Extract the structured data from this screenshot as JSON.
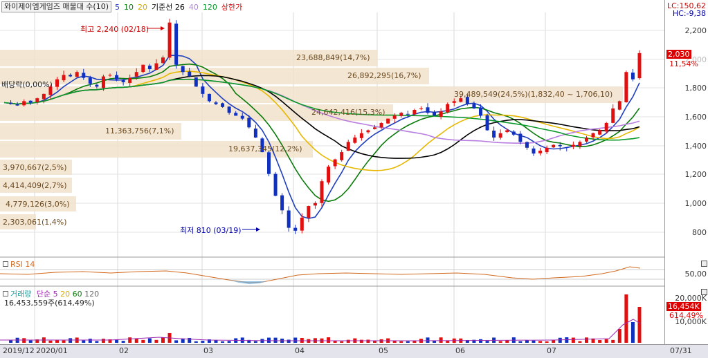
{
  "legend": {
    "title": "와이제이엠게임즈 매물대 수(10)",
    "ma": [
      "5",
      "10",
      "20",
      "기준선 26",
      "40",
      "120"
    ],
    "ma_colors": [
      "#1f3fbf",
      "#0a7a0a",
      "#e6b800",
      "#000000",
      "#b77de0",
      "#0a9a2a"
    ],
    "extra": "상한가"
  },
  "info": {
    "lc": "LC:150,62",
    "hc": "HC:-9,38"
  },
  "price_axis": {
    "ticks": [
      "2,200",
      "2,000",
      "1,800",
      "1,600",
      "1,400",
      "1,200",
      "1,000",
      "800"
    ],
    "current": "2,030",
    "change": "11,54%"
  },
  "annotations": {
    "high": "최고 2,240 (02/18)",
    "low": "최저 810 (03/19)",
    "dividend": "배당락(0,00%)"
  },
  "volume_profile": [
    {
      "text": "23,688,849(14,7%)"
    },
    {
      "text": "26,892,295(16,7%)"
    },
    {
      "text": "39,489,549(24,5%)(1,832,40 ~ 1,706,10)"
    },
    {
      "text": "24,642,416(15,3%)"
    },
    {
      "text": "11,363,756(7,1%)"
    },
    {
      "text": "19,637,345(12,2%)"
    },
    {
      "text": "3,970,667(2,5%)"
    },
    {
      "text": "4,414,409(2,7%)"
    },
    {
      "text": "4,779,126(3,0%)"
    },
    {
      "text": "2,303,061(1,4%)"
    }
  ],
  "rsi": {
    "label": "RSI 14",
    "tick": "50,00"
  },
  "volume": {
    "label": "거래량",
    "ma_label": "단순",
    "ma": [
      "5",
      "20",
      "60",
      "120"
    ],
    "value": "16,453,559주(614,49%)",
    "ticks": [
      "20,000K",
      "10,000K"
    ],
    "current": "16,454K",
    "pct": "614,49%"
  },
  "x_axis": {
    "ticks": [
      "2019/12",
      "2020/01",
      "02",
      "03",
      "04",
      "05",
      "06",
      "07"
    ],
    "end": "07/31"
  },
  "chart_data": {
    "type": "candlestick",
    "title": "와이제이엠게임즈 매물대 수(10)",
    "ylim": [
      700,
      2300
    ],
    "price_path": [
      1690,
      1680,
      1670,
      1700,
      1690,
      1720,
      1750,
      1800,
      1850,
      1880,
      1870,
      1900,
      1860,
      1820,
      1800,
      1870,
      1880,
      1850,
      1830,
      1860,
      1900,
      1950,
      1920,
      1960,
      2000,
      2240,
      1950,
      1900,
      1870,
      1800,
      1750,
      1700,
      1680,
      1660,
      1620,
      1600,
      1580,
      1520,
      1450,
      1350,
      1200,
      1050,
      950,
      830,
      810,
      900,
      980,
      1000,
      1150,
      1250,
      1300,
      1350,
      1420,
      1450,
      1480,
      1500,
      1520,
      1550,
      1580,
      1600,
      1620,
      1610,
      1640,
      1650,
      1620,
      1600,
      1630,
      1680,
      1700,
      1720,
      1680,
      1650,
      1600,
      1500,
      1450,
      1480,
      1500,
      1470,
      1420,
      1380,
      1340,
      1360,
      1380,
      1400,
      1390,
      1380,
      1400,
      1420,
      1450,
      1480,
      1500,
      1550,
      1650,
      1700,
      1900,
      1850,
      2030
    ]
  }
}
